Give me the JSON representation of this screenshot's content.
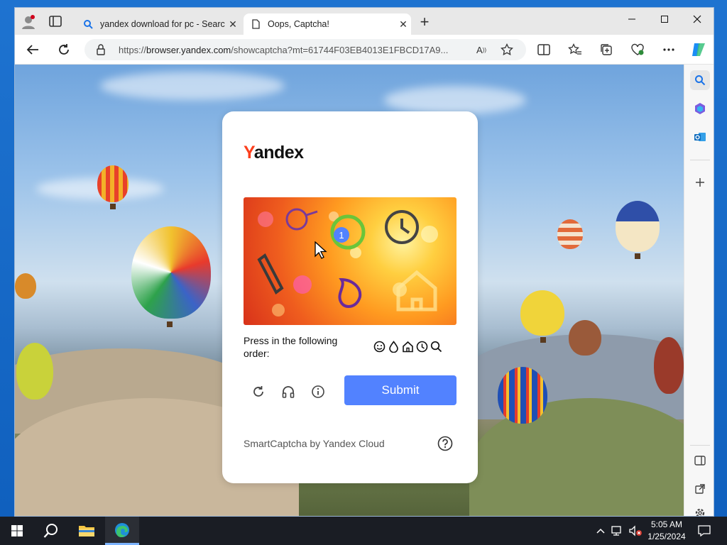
{
  "browser": {
    "tabs": [
      {
        "title": "yandex download for pc - Search",
        "favicon": "search-icon",
        "active": false
      },
      {
        "title": "Oops, Captcha!",
        "favicon": "page-icon",
        "active": true
      }
    ],
    "address": {
      "prefix": "https://",
      "host": "browser.yandex.com",
      "rest": "/showcaptcha?mt=61744F03EB4013E1FBCD17A9..."
    },
    "window_controls": [
      "minimize",
      "maximize",
      "close"
    ]
  },
  "captcha": {
    "logo_first": "Y",
    "logo_rest": "andex",
    "instruction": "Press in the following order:",
    "order_icons": [
      "smiley-icon",
      "drop-icon",
      "house-icon",
      "clock-icon",
      "search-icon"
    ],
    "marker_number": "1",
    "submit_label": "Submit",
    "footer": "SmartCaptcha by Yandex Cloud",
    "accent_color": "#5282ff"
  },
  "taskbar": {
    "time": "5:05 AM",
    "date": "1/25/2024"
  }
}
